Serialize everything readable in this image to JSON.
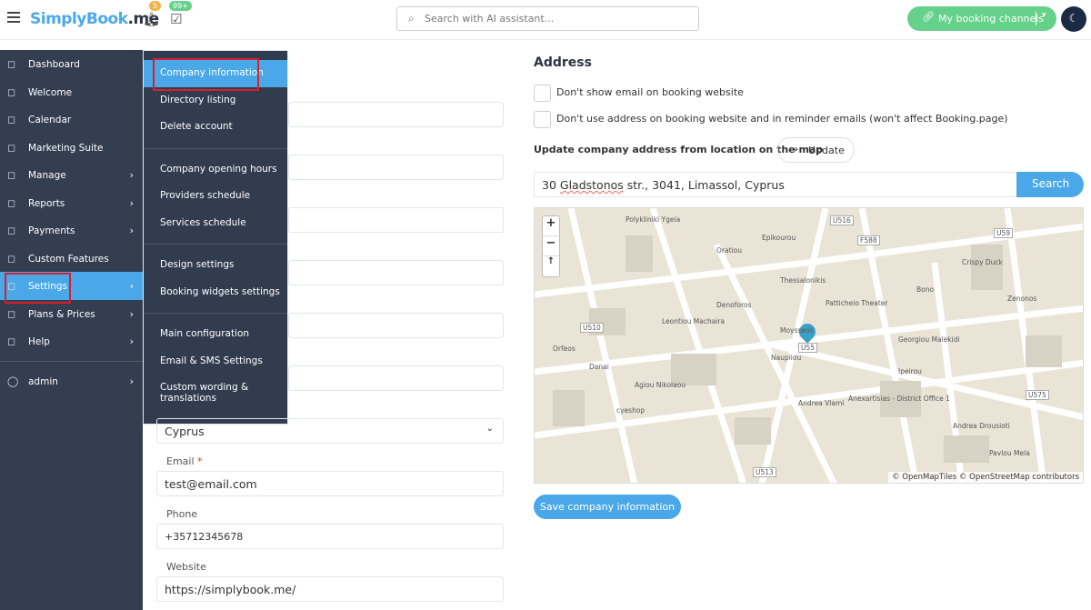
{
  "header": {
    "logo": "SimplyBook",
    "logo_suffix": ".me",
    "notifications_count": "5",
    "bookings_count": "99+",
    "search_placeholder": "Search with AI assistant...",
    "channels_label": "My booking channels"
  },
  "sidebar": {
    "items": [
      {
        "label": "Dashboard",
        "icon": "dashboard-icon",
        "arrow": false
      },
      {
        "label": "Welcome",
        "icon": "bulb-icon",
        "arrow": false
      },
      {
        "label": "Calendar",
        "icon": "calendar-icon",
        "arrow": false
      },
      {
        "label": "Marketing Suite",
        "icon": "megaphone-icon",
        "arrow": false
      },
      {
        "label": "Manage",
        "icon": "pencil-icon",
        "arrow": true
      },
      {
        "label": "Reports",
        "icon": "chart-icon",
        "arrow": true
      },
      {
        "label": "Payments",
        "icon": "payments-icon",
        "arrow": true
      },
      {
        "label": "Custom Features",
        "icon": "puzzle-icon",
        "arrow": false
      },
      {
        "label": "Settings",
        "icon": "gear-icon",
        "arrow": true,
        "active": true
      },
      {
        "label": "Plans & Prices",
        "icon": "money-icon",
        "arrow": true
      },
      {
        "label": "Help",
        "icon": "chat-icon",
        "arrow": true
      }
    ],
    "user": "admin"
  },
  "settings_menu": {
    "groups": [
      [
        "Company information",
        "Directory listing",
        "Delete account"
      ],
      [
        "Company opening hours",
        "Providers schedule",
        "Services schedule"
      ],
      [
        "Design settings",
        "Booking widgets settings"
      ],
      [
        "Main configuration",
        "Email & SMS Settings",
        "Custom wording & translations"
      ]
    ]
  },
  "form": {
    "country": "Cyprus",
    "email_label": "Email",
    "email": "test@email.com",
    "phone_label": "Phone",
    "phone": "+35712345678",
    "website_label": "Website",
    "website": "https://simplybook.me/"
  },
  "address": {
    "title": "Address",
    "checkbox1": "Don't show email on booking website",
    "checkbox2": "Don't use address on booking website and in reminder emails (won't affect Booking.page)",
    "update_text": "Update company address from location on the map",
    "update_button": "Update",
    "address_pre": "30 ",
    "address_word": "Gladstonos",
    "address_post": " str., 3041, Limassol, Cyprus",
    "search_button": "Search",
    "save_button": "Save company information"
  },
  "map": {
    "attribution": "© OpenMapTiles © OpenStreetMap contributors",
    "labels": [
      "Polykliniki Ygeia",
      "Epikourou",
      "Oratiou",
      "Thessalonikis",
      "Patticheio Theater",
      "Bono",
      "Crispy Duck",
      "Zenonos",
      "Denoforos",
      "Moysseos",
      "Naupliou",
      "Georgiou Malekidi",
      "Leontiou Machaira",
      "Agiou Nikolaou",
      "Orfeos",
      "Danai",
      "cyeshop",
      "Andrea Vlami",
      "Anexartisias - District Office 1",
      "Ipeirou",
      "Andrea Drousioti",
      "Pavlou Mela",
      "U516",
      "U59",
      "U510",
      "U55",
      "U513",
      "U575",
      "F588"
    ]
  },
  "colors": {
    "accent": "#4aa8e8",
    "sidebar": "#343e51",
    "green": "#66d18a",
    "highlight": "#d8202a"
  }
}
